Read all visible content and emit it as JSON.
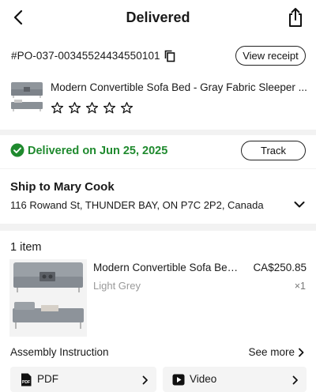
{
  "header": {
    "title": "Delivered",
    "back_icon": "chevron-left-icon",
    "share_icon": "share-icon"
  },
  "order": {
    "number": "#PO-037-00345524434550101",
    "copy_icon": "copy-icon",
    "view_receipt_label": "View receipt",
    "product_title": "Modern Convertible Sofa Bed - Gray Fabric Sleeper ...",
    "rating_stars": 0,
    "rating_max": 5
  },
  "status": {
    "text": "Delivered on Jun 25, 2025",
    "icon": "check-circle-icon",
    "track_label": "Track",
    "color": "#1f8a2e"
  },
  "shipping": {
    "name": "Ship to Mary Cook",
    "address": "116 Rowand St, THUNDER BAY, ON P7C 2P2, Canada"
  },
  "items": {
    "count_label": "1 item",
    "list": [
      {
        "name": "Modern Convertible Sofa Bed ...",
        "price": "CA$250.85",
        "variant": "Light Grey",
        "quantity": "×1"
      }
    ],
    "assembly_label": "Assembly Instruction",
    "see_more_label": "See more",
    "docs": {
      "pdf_label": "PDF",
      "video_label": "Video"
    }
  }
}
